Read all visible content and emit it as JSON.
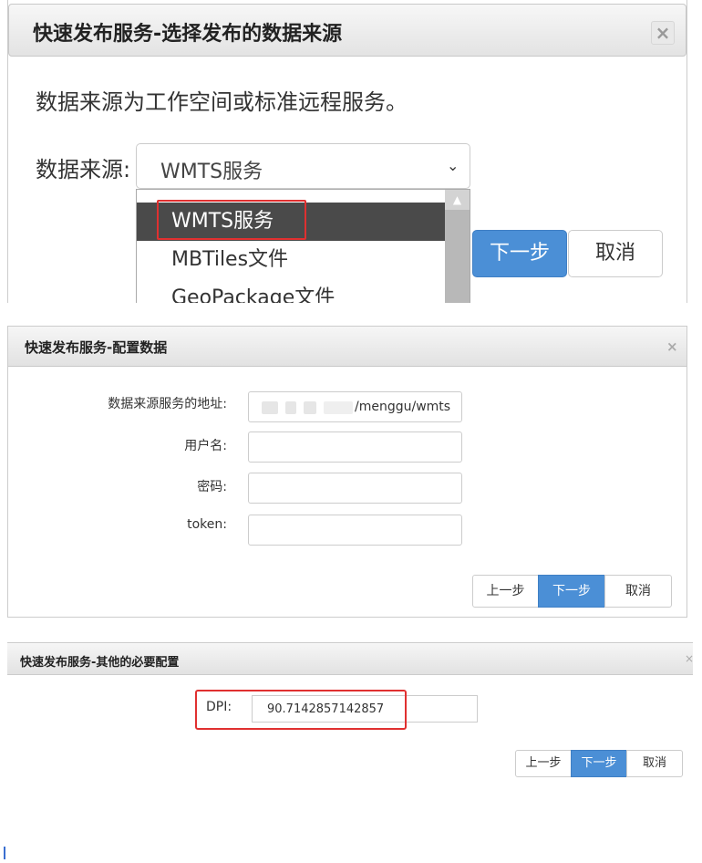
{
  "panel1": {
    "title": "快速发布服务-选择发布的数据来源",
    "close_glyph": "×",
    "description": "数据来源为工作空间或标准远程服务。",
    "source_label": "数据来源:",
    "selected_value": "WMTS服务",
    "options": [
      "WMTS服务",
      "MBTiles文件",
      "GeoPackage文件"
    ],
    "next_label": "下一步",
    "cancel_label": "取消"
  },
  "panel2": {
    "title": "快速发布服务-配置数据",
    "close_glyph": "×",
    "url_label": "数据来源服务的地址:",
    "url_value": "/menggu/wmts",
    "username_label": "用户名:",
    "password_label": "密码:",
    "token_label": "token:",
    "prev_label": "上一步",
    "next_label": "下一步",
    "cancel_label": "取消"
  },
  "panel3": {
    "title": "快速发布服务-其他的必要配置",
    "close_glyph": "×",
    "dpi_label": "DPI:",
    "dpi_value": "90.7142857142857",
    "prev_label": "上一步",
    "next_label": "下一步",
    "cancel_label": "取消"
  },
  "colors": {
    "primary": "#4b8fd6",
    "highlight": "#e03030",
    "selected_option": "#4a4a4a"
  }
}
